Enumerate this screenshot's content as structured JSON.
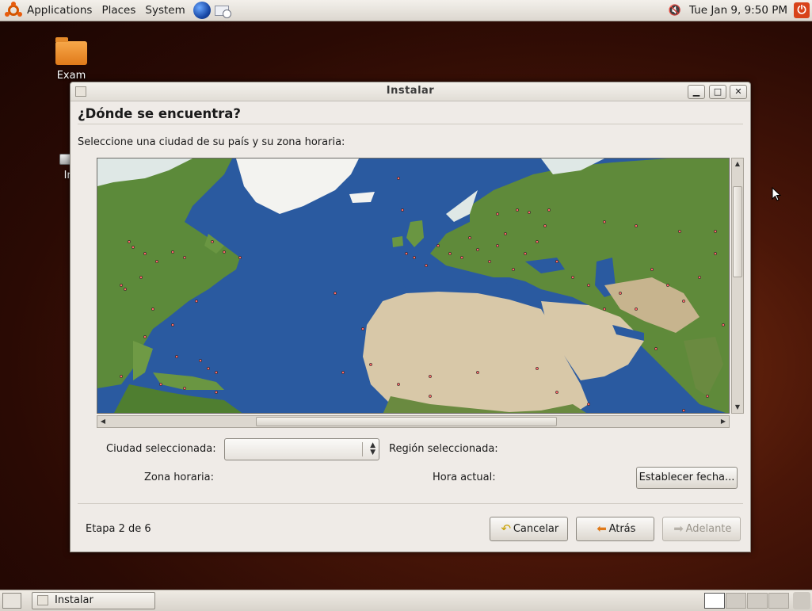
{
  "top_panel": {
    "menus": [
      "Applications",
      "Places",
      "System"
    ],
    "clock": "Tue Jan  9,  9:50 PM"
  },
  "desktop": {
    "icons": [
      {
        "label": "Exam"
      },
      {
        "label": "Ins"
      }
    ]
  },
  "window": {
    "title": "Instalar",
    "heading": "¿Dónde se encuentra?",
    "instruction": "Seleccione una ciudad de su país y su zona horaria:",
    "fields": {
      "ciudad_label": "Ciudad seleccionada:",
      "ciudad_value": "",
      "region_label": "Región seleccionada:",
      "zona_label": "Zona horaria:",
      "hora_label": "Hora actual:"
    },
    "buttons": {
      "establecer": "Establecer fecha...",
      "cancelar": "Cancelar",
      "atras": "Atrás",
      "adelante": "Adelante"
    },
    "step": "Etapa 2 de 6",
    "colors": {
      "ocean": "#2a5aa0",
      "land": "#5f8a3a",
      "desert": "#d8c8a8",
      "ice": "#f4f4f4"
    }
  },
  "bottom_panel": {
    "task_label": "Instalar"
  }
}
